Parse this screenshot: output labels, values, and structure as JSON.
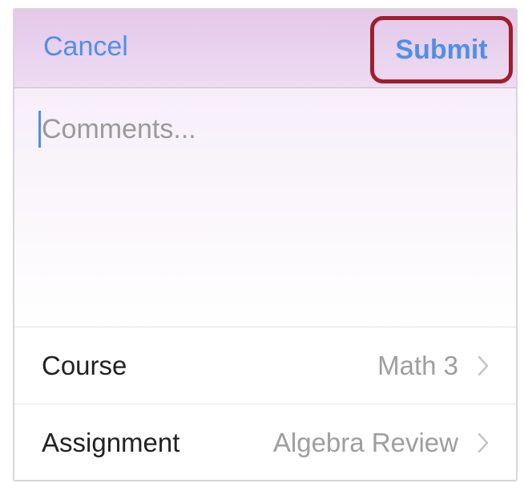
{
  "header": {
    "cancel_label": "Cancel",
    "submit_label": "Submit"
  },
  "comments": {
    "placeholder": "Comments...",
    "value": ""
  },
  "rows": [
    {
      "label": "Course",
      "value": "Math 3",
      "icon": "chevron-right-icon"
    },
    {
      "label": "Assignment",
      "value": "Algebra Review",
      "icon": "chevron-right-icon"
    }
  ],
  "colors": {
    "accent": "#4f8fe8",
    "highlight_border": "#9c1f2b",
    "header_bg": "#e4c8e8"
  }
}
